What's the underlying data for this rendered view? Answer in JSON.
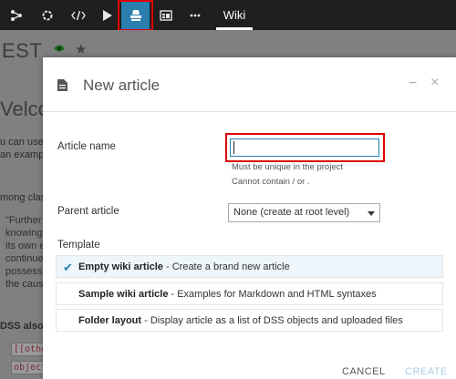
{
  "topbar": {
    "icons": [
      "flow-icon",
      "recipe-icon",
      "code-icon",
      "run-icon",
      "wiki-icon",
      "dashboard-icon",
      "more-icon"
    ],
    "wiki_tab": "Wiki",
    "active_color": "#2a7fae",
    "highlight_color": "#e00000"
  },
  "background_page": {
    "title": "EST",
    "welcome": "Velco",
    "lines": [
      "u can use",
      "an examp",
      "mong clas",
      "\"Further",
      "knowing",
      "its own e",
      "continue",
      "possess,",
      "the caus",
      "DSS also",
      "[[othe",
      "object"
    ]
  },
  "modal": {
    "title": "New article",
    "minimize_label": "−",
    "close_label": "×",
    "article_name_label": "Article name",
    "article_name_value": "",
    "hint_unique": "Must be unique in the project",
    "hint_chars": "Cannot contain / or .",
    "parent_label": "Parent article",
    "parent_value": "None (create at root level)",
    "template_label": "Template",
    "templates": [
      {
        "name": "Empty wiki article",
        "desc": " - Create a brand new article",
        "selected": true
      },
      {
        "name": "Sample wiki article",
        "desc": " - Examples for Markdown and HTML syntaxes",
        "selected": false
      },
      {
        "name": "Folder layout",
        "desc": " - Display article as a list of DSS objects and uploaded files",
        "selected": false
      }
    ],
    "cancel_label": "CANCEL",
    "create_label": "CREATE"
  }
}
